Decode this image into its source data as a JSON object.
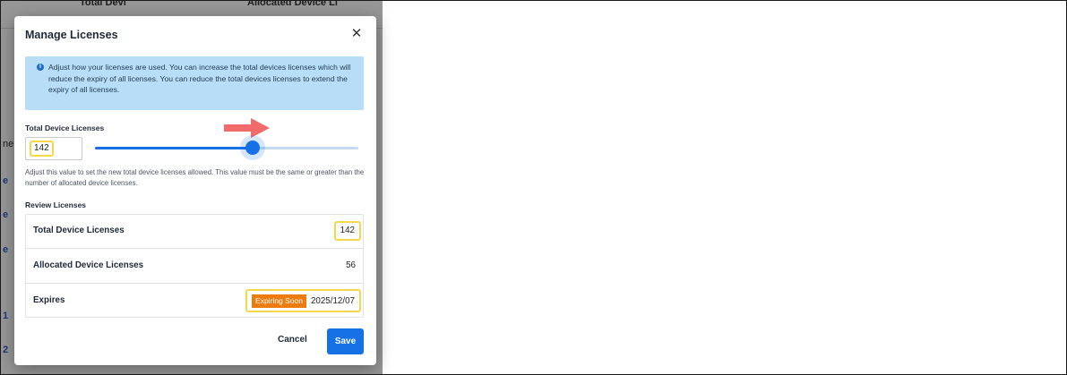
{
  "background": {
    "column_headers": [
      "Total Devi",
      "Allocated Device Li"
    ],
    "side_marks": [
      "ne",
      "e",
      "e",
      "e",
      "1",
      "2"
    ]
  },
  "modal": {
    "title": "Manage Licenses",
    "close_icon": "close-icon",
    "info": {
      "icon": "info-icon",
      "text": "Adjust how your licenses are used. You can increase the total devices licenses which will reduce the expiry of all licenses. You can reduce the total devices licenses to extend the expiry of all licenses."
    },
    "total_device_licenses": {
      "label": "Total Device Licenses",
      "value": "142",
      "slider_position": 0.6,
      "help": "Adjust this value to set the new total device licenses allowed. This value must be the same or greater than the number of allocated device licenses."
    },
    "review": {
      "title": "Review Licenses",
      "rows": [
        {
          "label": "Total Device Licenses",
          "value": "142"
        },
        {
          "label": "Allocated Device Licenses",
          "value": "56"
        },
        {
          "label": "Expires",
          "badge": "Expiring Soon",
          "value": "2025/12/07"
        }
      ]
    },
    "buttons": {
      "cancel": "Cancel",
      "save": "Save"
    }
  },
  "colors": {
    "primary": "#1670e6",
    "info_bg": "#b8def7",
    "highlight": "#f5d84a",
    "warning_badge": "#ee7b0f",
    "arrow": "#f26b6b"
  }
}
